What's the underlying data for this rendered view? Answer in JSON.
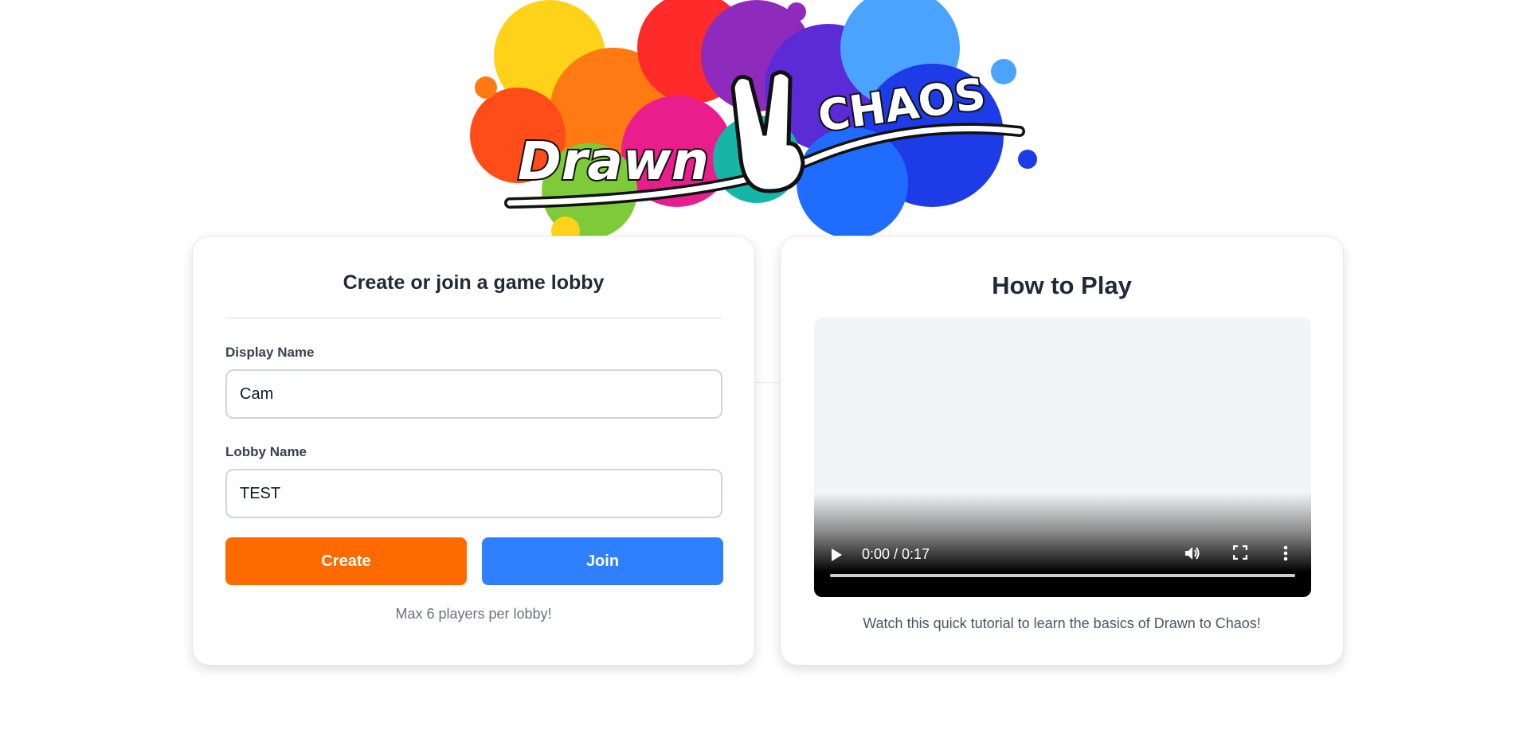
{
  "logo": {
    "word1": "Drawn",
    "word2": "CHAOS"
  },
  "lobby_card": {
    "title": "Create or join a game lobby",
    "display_name_label": "Display Name",
    "display_name_value": "Cam",
    "lobby_name_label": "Lobby Name",
    "lobby_name_value": "TEST",
    "create_label": "Create",
    "join_label": "Join",
    "hint": "Max 6 players per lobby!"
  },
  "how_to_card": {
    "title": "How to Play",
    "video_time": "0:00 / 0:17",
    "video_progress": 0,
    "caption": "Watch this quick tutorial to learn the basics of Drawn to Chaos!"
  },
  "colors": {
    "create_button": "#ff6a00",
    "join_button": "#2f80ff"
  },
  "icons": {
    "logo_hand": "peace-hand-icon",
    "play": "play-icon",
    "volume": "volume-icon",
    "fullscreen": "fullscreen-icon",
    "more": "more-vert-icon"
  }
}
